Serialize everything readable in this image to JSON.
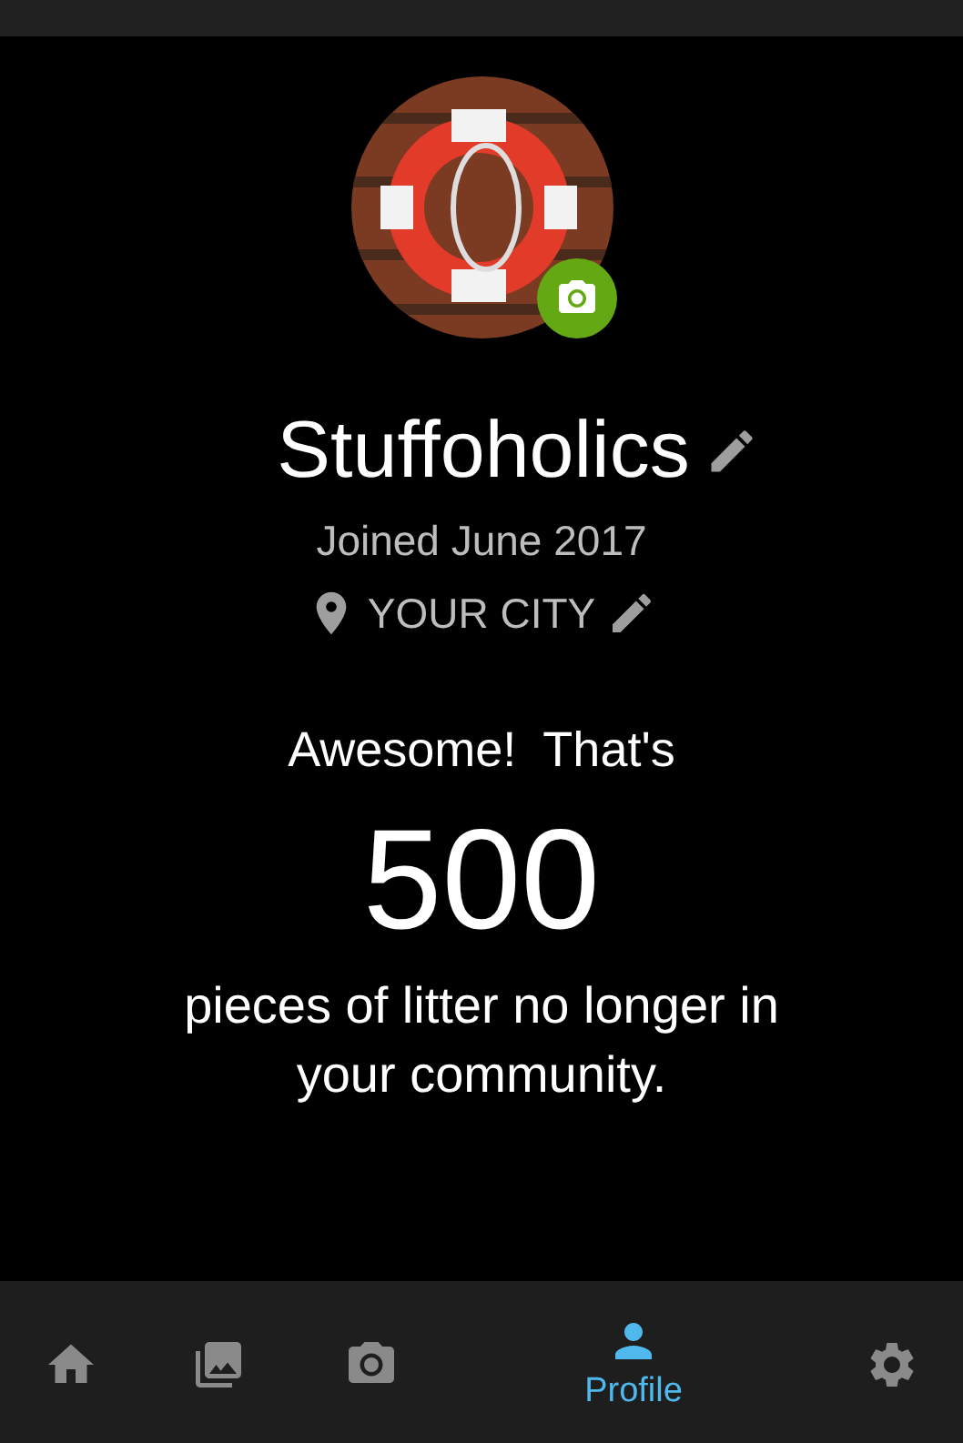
{
  "profile": {
    "name": "Stuffoholics",
    "joined": "Joined June 2017",
    "location": "YOUR CITY"
  },
  "message": {
    "intro": "Awesome!  That's",
    "count": "500",
    "outro": "pieces of litter no longer in your community."
  },
  "nav": [
    {
      "kind": "home",
      "selected": false
    },
    {
      "kind": "gallery",
      "selected": false
    },
    {
      "kind": "camera",
      "selected": false
    },
    {
      "kind": "person",
      "label": "Profile",
      "selected": true
    },
    {
      "kind": "settings",
      "selected": false
    }
  ]
}
